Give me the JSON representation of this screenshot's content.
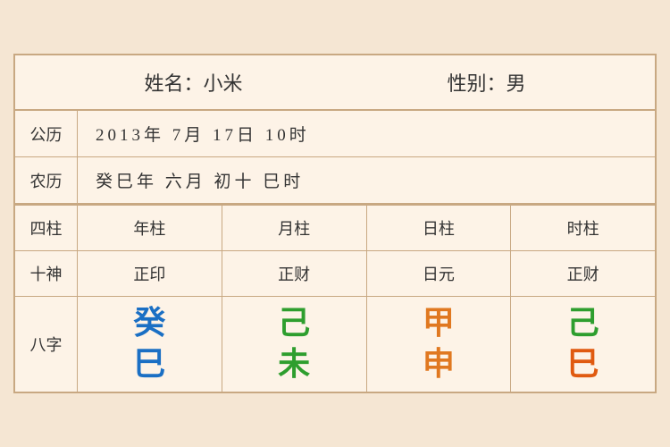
{
  "header": {
    "name_label": "姓名：小米",
    "gender_label": "性别：男"
  },
  "solar": {
    "label": "公历",
    "value": "2013年 7月 17日 10时"
  },
  "lunar": {
    "label": "农历",
    "value": "癸巳年 六月 初十 巳时"
  },
  "columns": {
    "label": "四柱",
    "headers": [
      "年柱",
      "月柱",
      "日柱",
      "时柱"
    ]
  },
  "shishen": {
    "label": "十神",
    "values": [
      "正印",
      "正财",
      "日元",
      "正财"
    ]
  },
  "bazi": {
    "label": "八字",
    "items": [
      {
        "top": "癸",
        "bottom": "巳",
        "top_color": "color-blue",
        "bottom_color": "color-blue"
      },
      {
        "top": "己",
        "bottom": "未",
        "top_color": "color-green",
        "bottom_color": "color-green"
      },
      {
        "top": "甲",
        "bottom": "申",
        "top_color": "color-orange",
        "bottom_color": "color-orange"
      },
      {
        "top": "己",
        "bottom": "巳",
        "top_color": "color-green",
        "bottom_color": "color-red-orange"
      }
    ]
  }
}
